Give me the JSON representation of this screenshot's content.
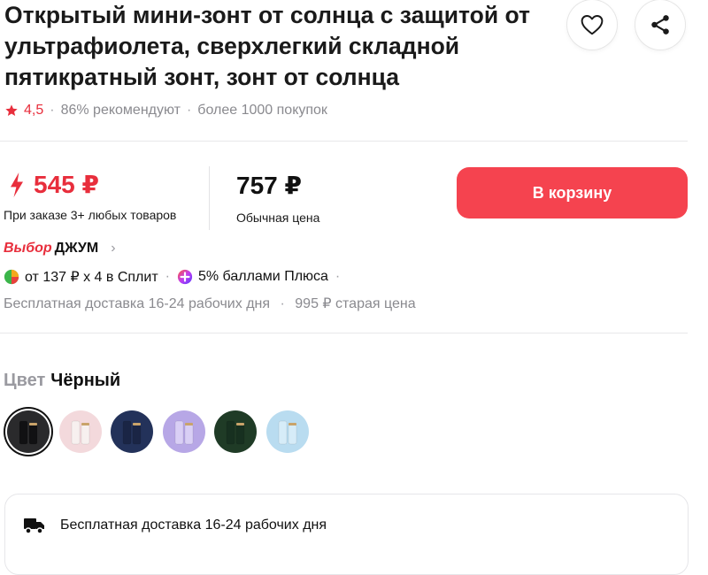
{
  "product": {
    "title": "Открытый мини-зонт от солнца с защитой от ультрафиолета, сверхлегкий складной пятикратный зонт, зонт от солнца",
    "rating": "4,5",
    "recommend": "86% рекомендуют",
    "purchases": "более 1000 покупок"
  },
  "actions": {
    "favorite_icon": "heart-icon",
    "share_icon": "share-icon"
  },
  "pricing": {
    "split_price": "545 ₽",
    "split_note": "При заказе 3+ любых товаров",
    "regular_price": "757 ₽",
    "regular_note": "Обычная цена",
    "cart_button": "В корзину"
  },
  "choice": {
    "badge": "Выбор",
    "label": "ДЖУМ"
  },
  "payment": {
    "split_text": "от 137 ₽ x 4 в Сплит",
    "plus_text": "5% баллами Плюса",
    "separator": "·"
  },
  "delivery": {
    "free_text": "Бесплатная доставка 16-24 рабочих дня",
    "old_price": "995 ₽ старая цена",
    "card_text": "Бесплатная доставка 16-24 рабочих дня"
  },
  "color": {
    "label": "Цвет",
    "selected": "Чёрный",
    "swatches": [
      {
        "name": "Чёрный",
        "bg": "#2a2a2c",
        "body": "#111113"
      },
      {
        "name": "Розовый",
        "bg": "#f3d9dc",
        "body": "#f7f0ef"
      },
      {
        "name": "Тёмно-синий",
        "bg": "#23325a",
        "body": "#1a2545"
      },
      {
        "name": "Лавандовый",
        "bg": "#b7a7e6",
        "body": "#d9cff5"
      },
      {
        "name": "Зелёный",
        "bg": "#1f3b26",
        "body": "#173020"
      },
      {
        "name": "Голубой",
        "bg": "#b9dcf0",
        "body": "#d6ecf8"
      }
    ]
  },
  "colors": {
    "accent": "#f5434f",
    "rating": "#e82e3c",
    "muted": "#8a8a8f"
  }
}
